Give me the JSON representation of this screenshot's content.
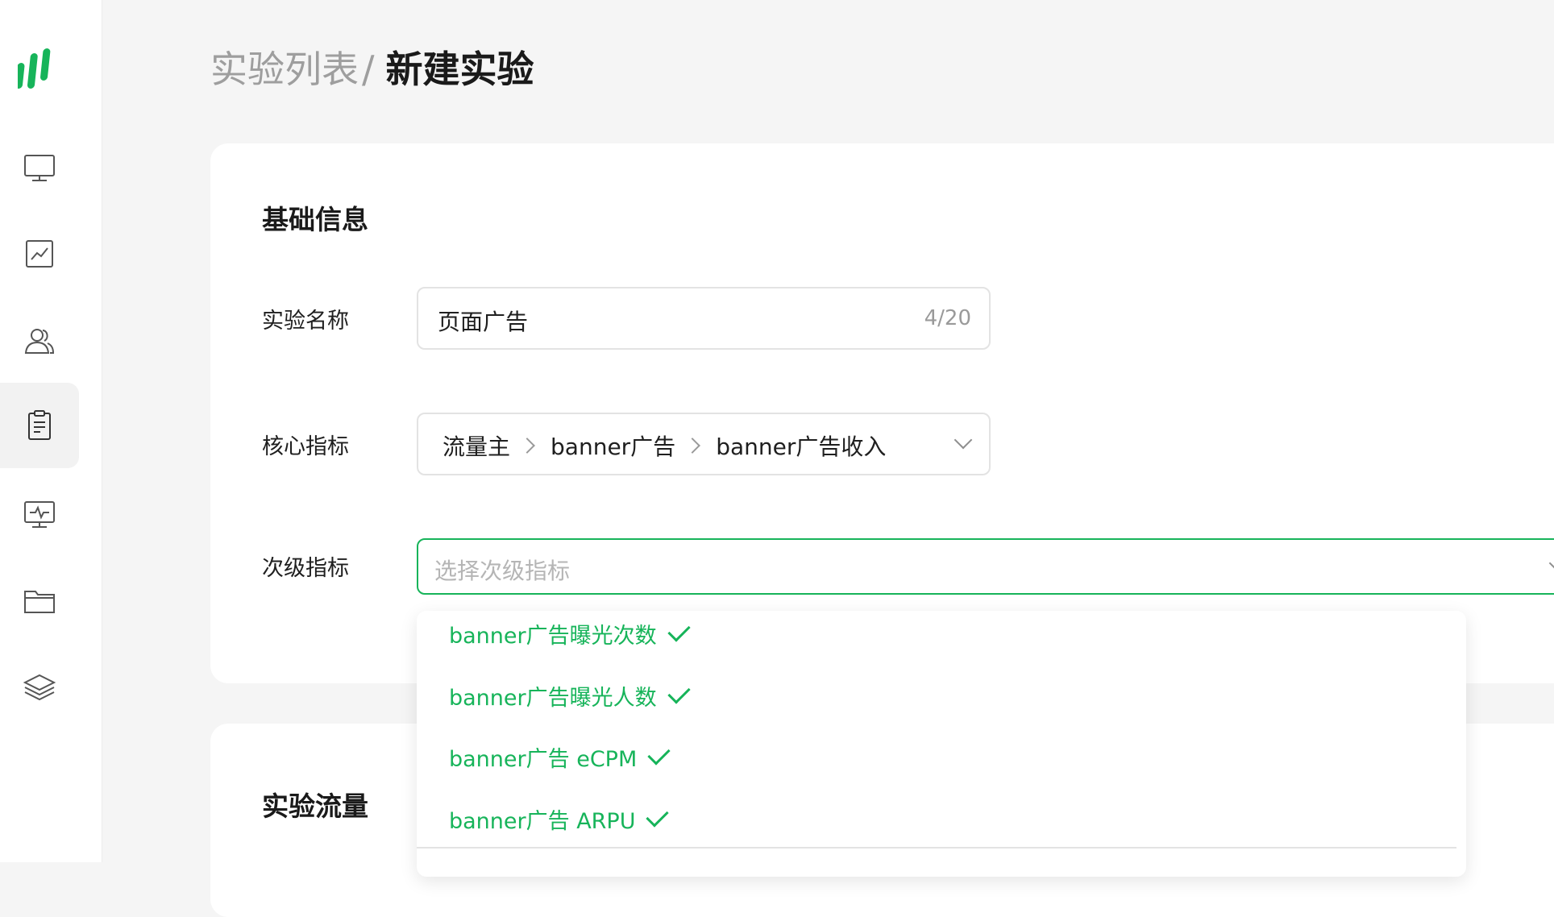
{
  "sidebar": {
    "logo": "brand-logo",
    "items": [
      {
        "icon": "monitor-icon",
        "active": false
      },
      {
        "icon": "line-chart-icon",
        "active": false
      },
      {
        "icon": "users-icon",
        "active": false
      },
      {
        "icon": "clipboard-icon",
        "active": true
      },
      {
        "icon": "monitor-pulse-icon",
        "active": false
      },
      {
        "icon": "folder-icon",
        "active": false
      },
      {
        "icon": "layers-icon",
        "active": false
      }
    ]
  },
  "breadcrumb": {
    "parent": "实验列表",
    "separator": "/",
    "current": "新建实验"
  },
  "basic_info": {
    "title": "基础信息",
    "name_field": {
      "label": "实验名称",
      "value": "页面广告",
      "count": "4/20"
    },
    "core_metric": {
      "label": "核心指标",
      "path": [
        "流量主",
        "banner广告",
        "banner广告收入"
      ]
    },
    "secondary_metric": {
      "label": "次级指标",
      "placeholder": "选择次级指标",
      "options": [
        {
          "label": "banner广告曝光次数",
          "selected": true
        },
        {
          "label": "banner广告曝光人数",
          "selected": true
        },
        {
          "label": "banner广告 eCPM",
          "selected": true
        },
        {
          "label": "banner广告 ARPU",
          "selected": true
        }
      ]
    }
  },
  "traffic": {
    "title": "实验流量"
  },
  "colors": {
    "accent": "#17b45a",
    "background": "#f5f5f5",
    "card": "#ffffff",
    "muted_text": "#9e9e9e"
  }
}
